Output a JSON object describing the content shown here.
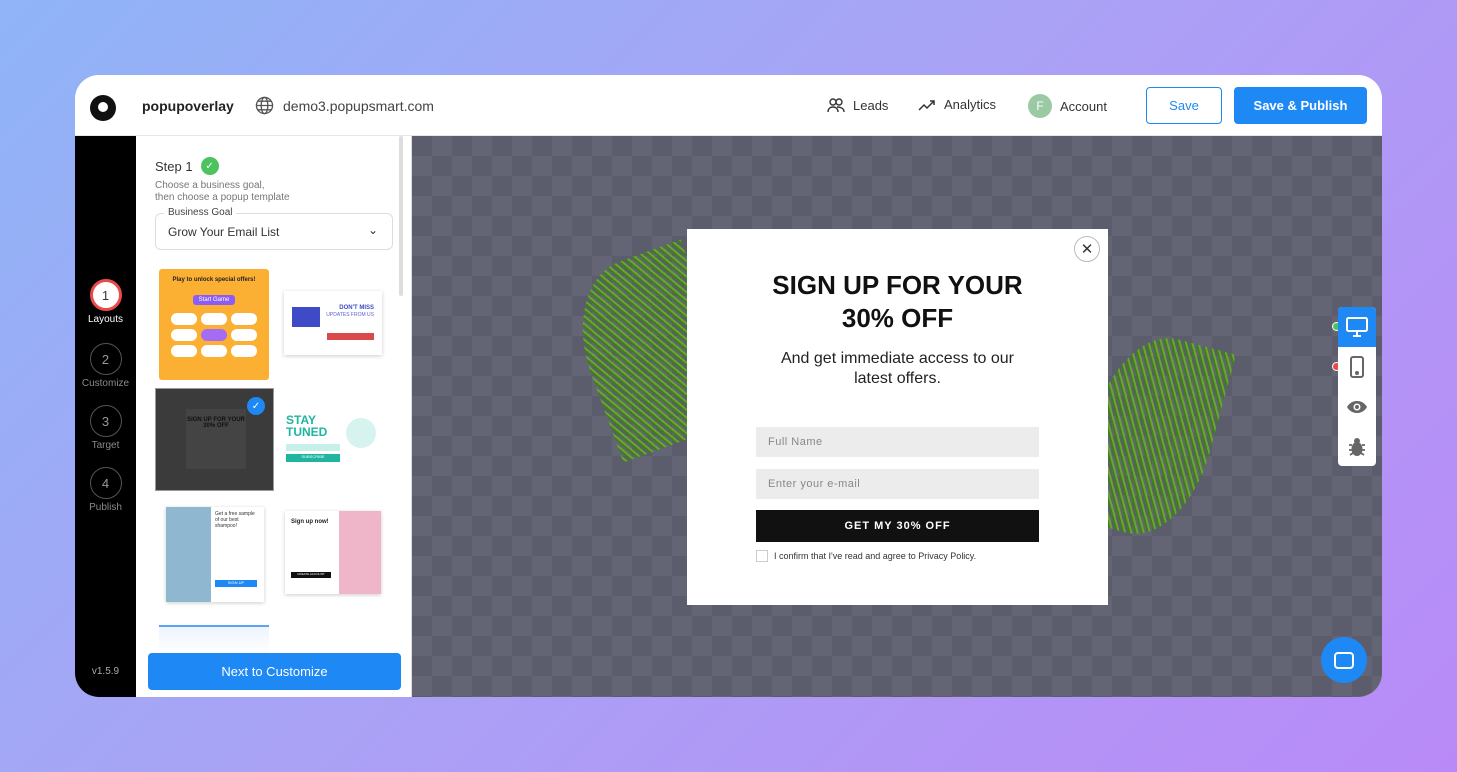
{
  "header": {
    "brand": "popupoverlay",
    "site": "demo3.popupsmart.com",
    "nav": [
      {
        "label": "Leads",
        "icon": "leads-icon"
      },
      {
        "label": "Analytics",
        "icon": "analytics-icon"
      }
    ],
    "account": {
      "initial": "F",
      "label": "Account"
    },
    "save": "Save",
    "save_publish": "Save & Publish"
  },
  "rail": {
    "steps": [
      {
        "n": "1",
        "label": "Layouts",
        "active": true
      },
      {
        "n": "2",
        "label": "Customize"
      },
      {
        "n": "3",
        "label": "Target"
      },
      {
        "n": "4",
        "label": "Publish"
      }
    ],
    "version": "v1.5.9"
  },
  "panel": {
    "step": "Step 1",
    "desc1": "Choose a business goal,",
    "desc2": "then choose a popup template",
    "goal_label": "Business Goal",
    "goal_value": "Grow Your Email List",
    "next": "Next to Customize",
    "templates": [
      {
        "title": "Play to unlock special offers!",
        "cta": "Start Game"
      },
      {
        "title": "DON'T MISS",
        "sub": "UPDATES FROM US"
      },
      {
        "title": "SIGN UP FOR YOUR 30% OFF",
        "selected": true
      },
      {
        "title": "STAY TUNED",
        "cta": "SUBSCRIBE"
      },
      {
        "title": "Get a free sample of our best shampoo!",
        "cta": "SIGN UP"
      },
      {
        "title": "Sign up now!",
        "cta": "CREATE ACCOUNT"
      }
    ]
  },
  "popup": {
    "title1": "SIGN UP FOR YOUR",
    "title2": "30% OFF",
    "sub1": "And get immediate access to our",
    "sub2": "latest offers.",
    "name_placeholder": "Full Name",
    "email_placeholder": "Enter your e-mail",
    "button": "GET MY 30% OFF",
    "consent": "I confirm that I've read and agree to Privacy Policy."
  },
  "devices": [
    "desktop-icon",
    "mobile-icon",
    "eye-icon",
    "bug-icon"
  ],
  "colors": {
    "accent": "#1e88f5",
    "success": "#4cc35e",
    "danger": "#e94b4b"
  }
}
